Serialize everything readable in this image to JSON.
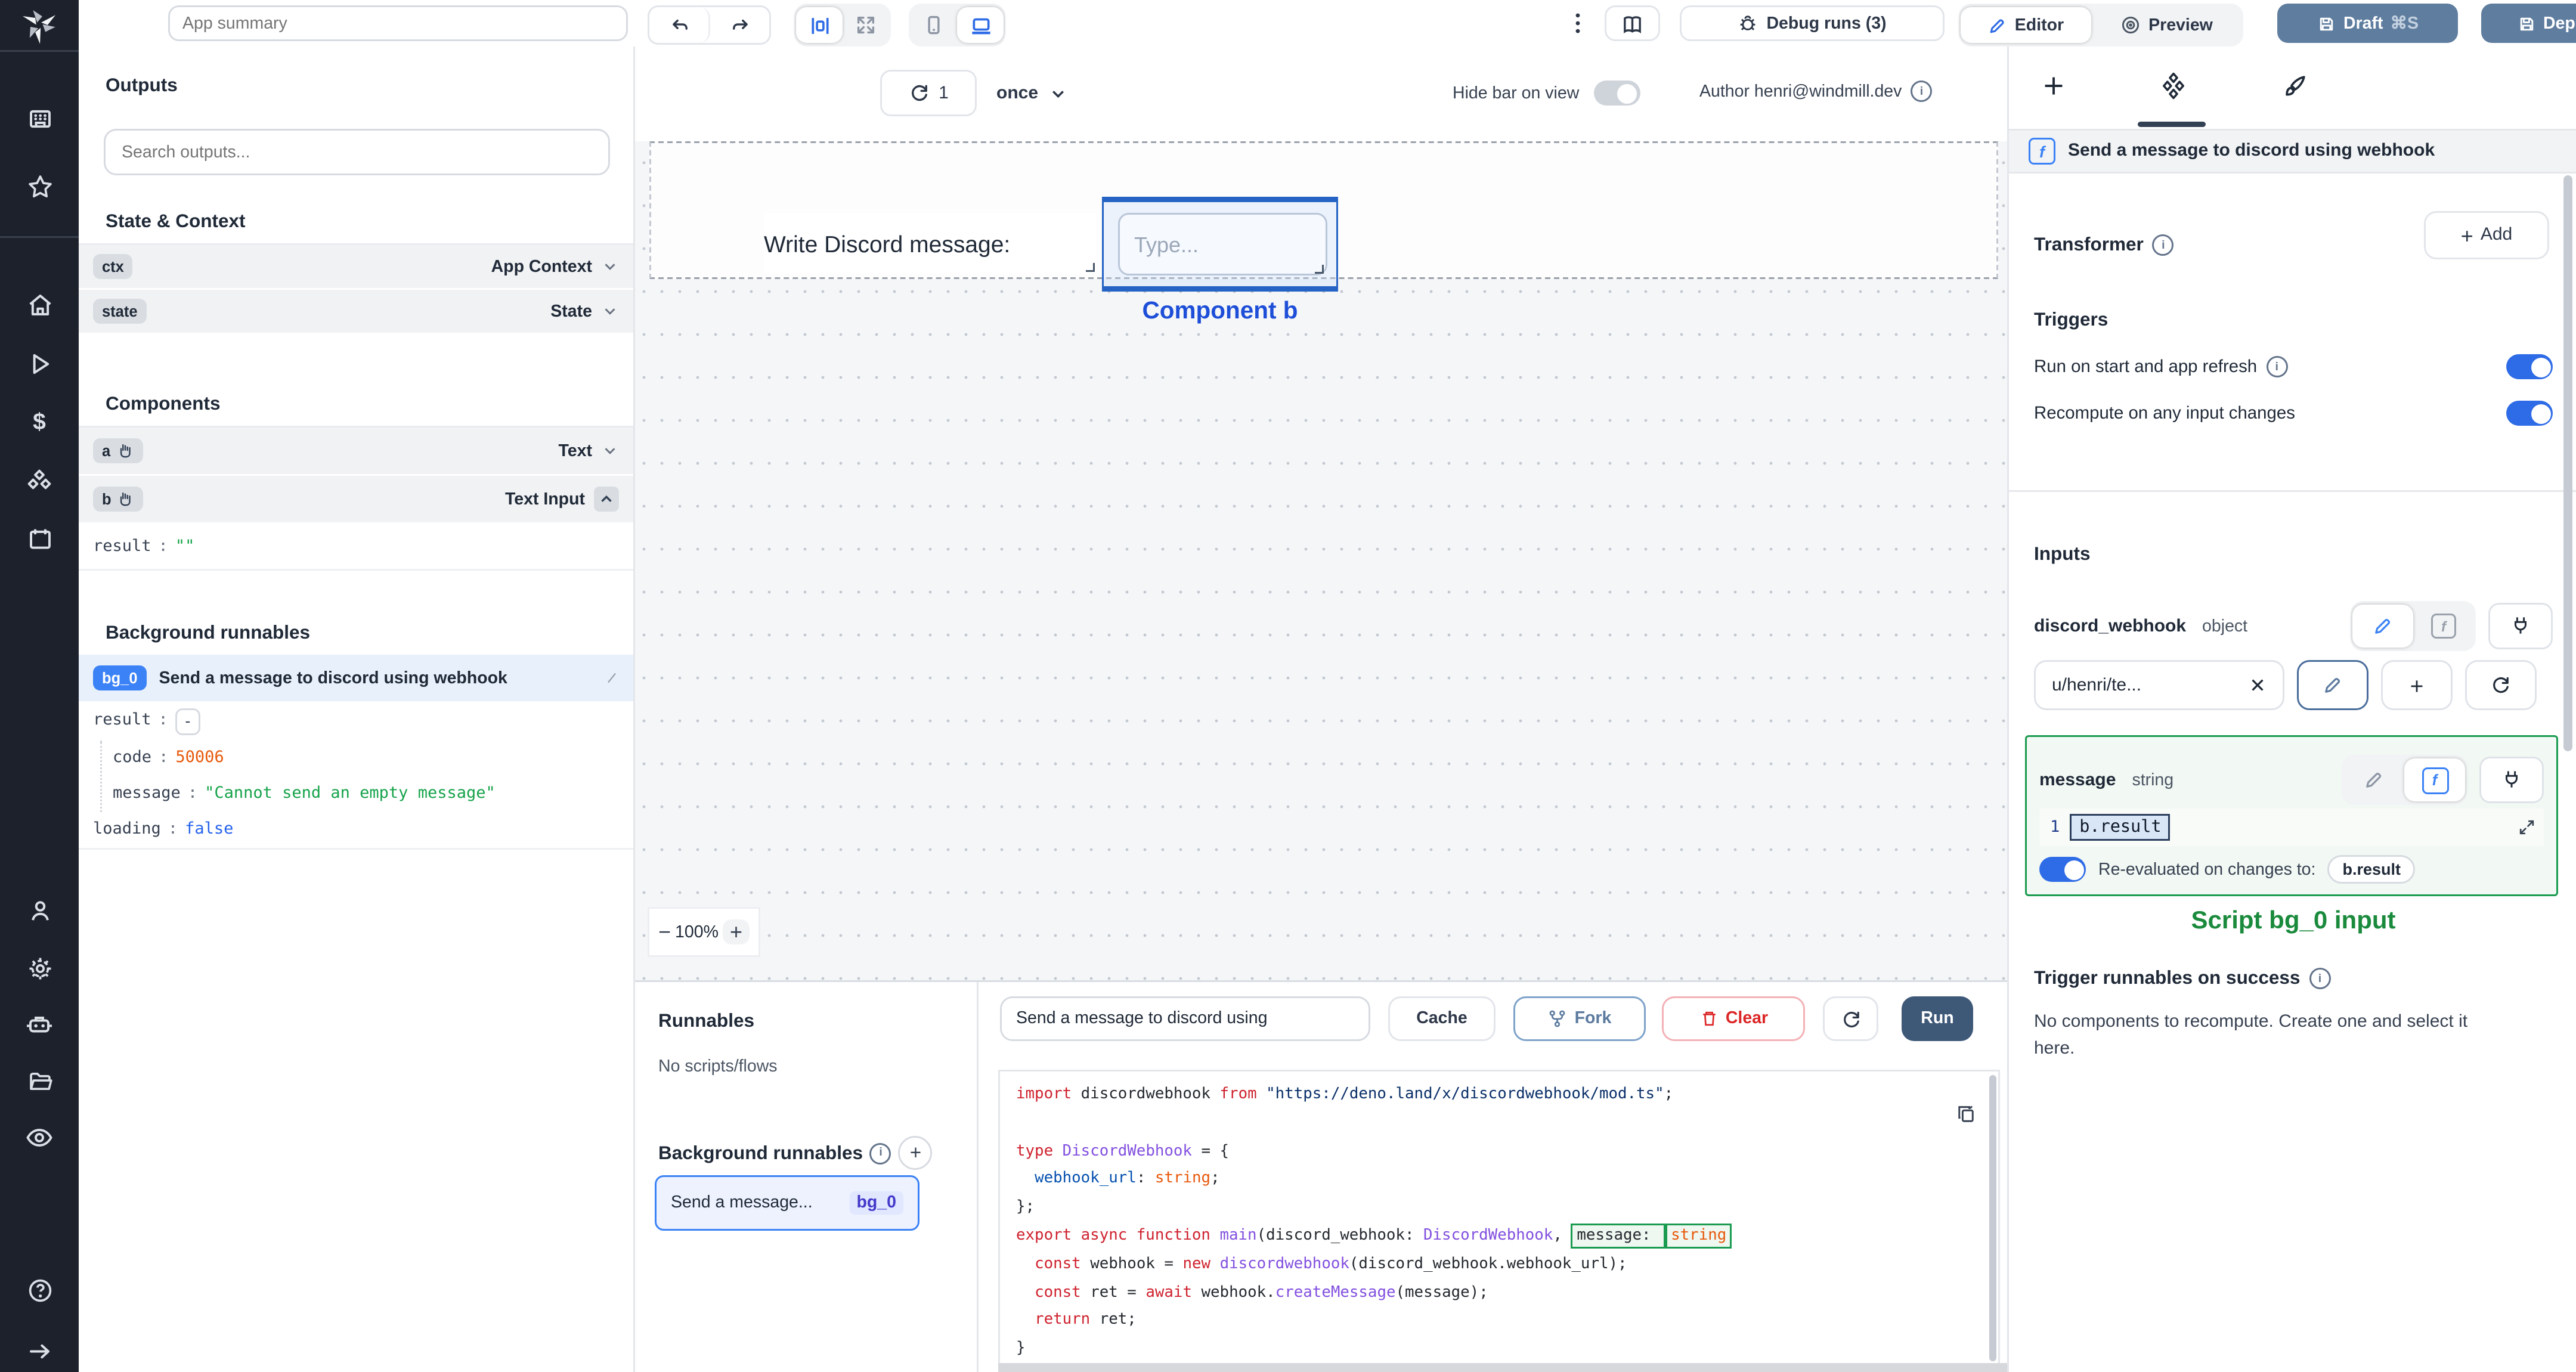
{
  "topbar": {
    "app_summary_placeholder": "App summary",
    "debug_runs_label": "Debug runs (3)",
    "editor_label": "Editor",
    "preview_label": "Preview",
    "draft_label": "Draft",
    "draft_shortcut": "⌘S",
    "deploy_label": "Deploy"
  },
  "canvas_toolbar": {
    "refresh_count": "1",
    "frequency": "once",
    "hide_bar_label": "Hide bar on view",
    "author_label": "Author henri@windmill.dev"
  },
  "outputs": {
    "title": "Outputs",
    "search_placeholder": "Search outputs...",
    "state_context_title": "State & Context",
    "ctx_key": "ctx",
    "ctx_type": "App Context",
    "state_key": "state",
    "state_type": "State",
    "components_title": "Components",
    "a_key": "a",
    "a_type": "Text",
    "b_key": "b",
    "b_type": "Text Input",
    "b_result_key": "result",
    "b_result_value": "\"\"",
    "background_title": "Background runnables",
    "bg_badge": "bg_0",
    "bg_name": "Send a message to discord using webhook",
    "result_key": "result",
    "result_collapse": "-",
    "code_key": "code",
    "code_value": "50006",
    "message_key": "message",
    "message_value": "\"Cannot send an empty message\"",
    "loading_key": "loading",
    "loading_value": "false"
  },
  "canvas": {
    "text_component": "Write Discord message:",
    "input_placeholder": "Type...",
    "selected_component_label": "Component b",
    "zoom_level": "100%"
  },
  "runnables": {
    "title": "Runnables",
    "empty_label": "No scripts/flows",
    "background_title": "Background runnables",
    "item_name": "Send a message...",
    "item_badge": "bg_0"
  },
  "code_panel": {
    "name_value": "Send a message to discord using",
    "cache_label": "Cache",
    "fork_label": "Fork",
    "clear_label": "Clear",
    "run_label": "Run",
    "lines": [
      [
        {
          "c": "k",
          "t": "import"
        },
        {
          "c": "d",
          "t": " discordwebhook "
        },
        {
          "c": "k",
          "t": "from"
        },
        {
          "c": "s",
          "t": " \"https://deno.land/x/discordwebhook/mod.ts\""
        },
        {
          "c": "d",
          "t": ";"
        }
      ],
      [],
      [
        {
          "c": "k",
          "t": "type"
        },
        {
          "c": "ty",
          "t": " DiscordWebhook"
        },
        {
          "c": "d",
          "t": " = {"
        }
      ],
      [
        {
          "c": "d",
          "t": "  "
        },
        {
          "c": "pr",
          "t": "webhook_url"
        },
        {
          "c": "d",
          "t": ": "
        },
        {
          "c": "bt",
          "t": "string"
        },
        {
          "c": "d",
          "t": ";"
        }
      ],
      [
        {
          "c": "d",
          "t": "};"
        }
      ],
      [
        {
          "c": "k",
          "t": "export async function"
        },
        {
          "c": "fn",
          "t": " main"
        },
        {
          "c": "d",
          "t": "(discord_webhook: "
        },
        {
          "c": "ty",
          "t": "DiscordWebhook"
        },
        {
          "c": "d",
          "t": ", "
        },
        {
          "c": "d",
          "t": "message: ",
          "h": true
        },
        {
          "c": "bt",
          "t": "string",
          "h": true
        }
      ],
      [
        {
          "c": "d",
          "t": "  "
        },
        {
          "c": "k",
          "t": "const"
        },
        {
          "c": "d",
          "t": " webhook = "
        },
        {
          "c": "k",
          "t": "new"
        },
        {
          "c": "fn",
          "t": " discordwebhook"
        },
        {
          "c": "d",
          "t": "(discord_webhook.webhook_url);"
        }
      ],
      [
        {
          "c": "d",
          "t": "  "
        },
        {
          "c": "k",
          "t": "const"
        },
        {
          "c": "d",
          "t": " ret = "
        },
        {
          "c": "k",
          "t": "await"
        },
        {
          "c": "d",
          "t": " webhook."
        },
        {
          "c": "fn",
          "t": "createMessage"
        },
        {
          "c": "d",
          "t": "(message);"
        }
      ],
      [
        {
          "c": "d",
          "t": "  "
        },
        {
          "c": "k",
          "t": "return"
        },
        {
          "c": "d",
          "t": " ret;"
        }
      ],
      [
        {
          "c": "d",
          "t": "}"
        }
      ]
    ]
  },
  "right_panel": {
    "header": "Send a message to discord using webhook",
    "transformer_label": "Transformer",
    "add_label": "Add",
    "triggers_title": "Triggers",
    "trigger_run_on_start": "Run on start and app refresh",
    "trigger_recompute": "Recompute on any input changes",
    "inputs_title": "Inputs",
    "discord_webhook_name": "discord_webhook",
    "discord_webhook_type": "object",
    "discord_webhook_value": "u/henri/te...",
    "message_name": "message",
    "message_type": "string",
    "message_line_number": "1",
    "message_value": "b.result",
    "reeval_label": "Re-evaluated on changes to:",
    "reeval_value": "b.result",
    "annotation": "Script bg_0 input",
    "on_success_title": "Trigger runnables on success",
    "on_success_body": "No components to recompute. Create one and select it here."
  },
  "colors": {
    "accent_blue": "#2e6be6",
    "steel_blue": "#5f7d9f",
    "annotation_green": "#1a8a3c",
    "badge_blue": "#3b82f6",
    "error_orange": "#e8590c",
    "string_green": "#16a34a",
    "bool_blue": "#2563eb"
  }
}
